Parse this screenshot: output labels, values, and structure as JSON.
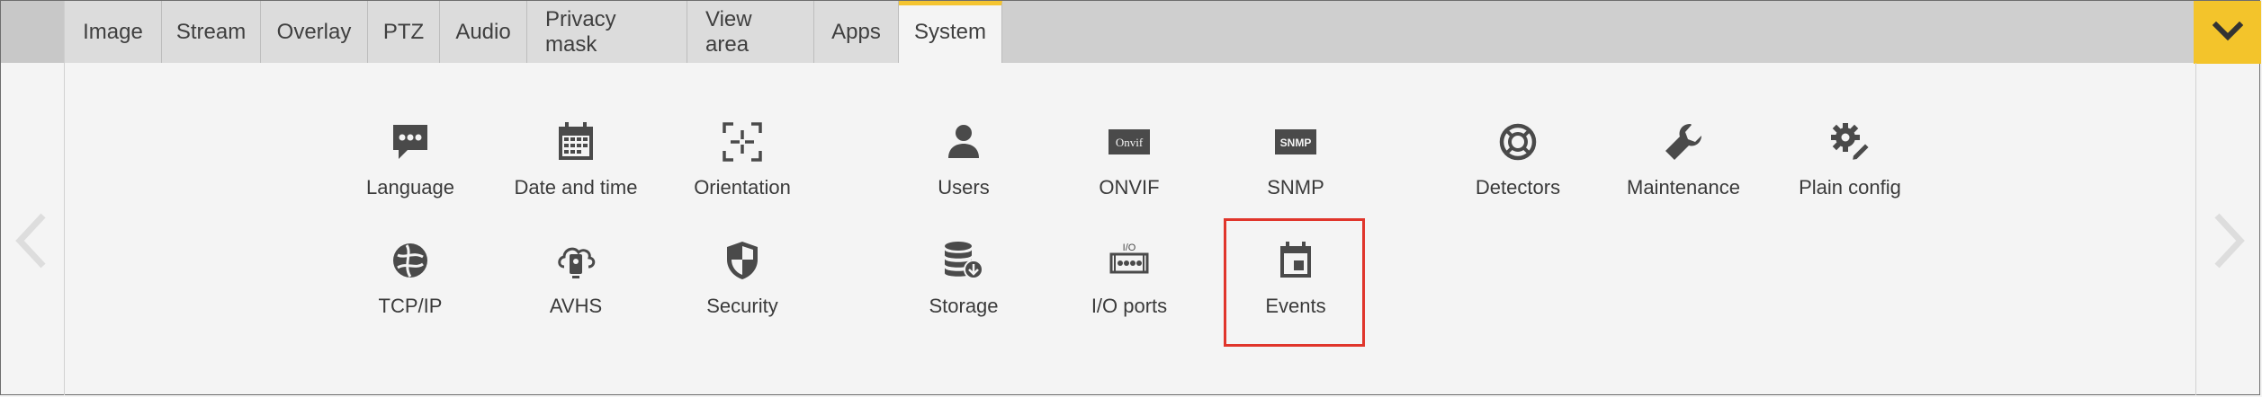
{
  "tabs": [
    {
      "label": "Image"
    },
    {
      "label": "Stream"
    },
    {
      "label": "Overlay"
    },
    {
      "label": "PTZ"
    },
    {
      "label": "Audio"
    },
    {
      "label": "Privacy mask"
    },
    {
      "label": "View area"
    },
    {
      "label": "Apps"
    },
    {
      "label": "System"
    }
  ],
  "active_tab": "System",
  "accent_color": "#f3c42b",
  "highlight_color": "#e0352b",
  "row1": [
    {
      "label": "Language",
      "icon": "chat-bubble-icon"
    },
    {
      "label": "Date and time",
      "icon": "calendar-icon"
    },
    {
      "label": "Orientation",
      "icon": "orientation-icon"
    },
    {
      "label": "Users",
      "icon": "user-icon"
    },
    {
      "label": "ONVIF",
      "icon": "onvif-icon",
      "icon_text": "Onvif"
    },
    {
      "label": "SNMP",
      "icon": "snmp-icon",
      "icon_text": "SNMP"
    },
    {
      "label": "Detectors",
      "icon": "detector-icon"
    },
    {
      "label": "Maintenance",
      "icon": "wrench-icon"
    },
    {
      "label": "Plain config",
      "icon": "gear-pencil-icon"
    }
  ],
  "row2": [
    {
      "label": "TCP/IP",
      "icon": "network-globe-icon"
    },
    {
      "label": "AVHS",
      "icon": "cloud-device-icon"
    },
    {
      "label": "Security",
      "icon": "shield-icon"
    },
    {
      "label": "Storage",
      "icon": "storage-icon"
    },
    {
      "label": "I/O ports",
      "icon": "io-ports-icon",
      "icon_text": "I/O"
    },
    {
      "label": "Events",
      "icon": "event-calendar-icon"
    }
  ]
}
